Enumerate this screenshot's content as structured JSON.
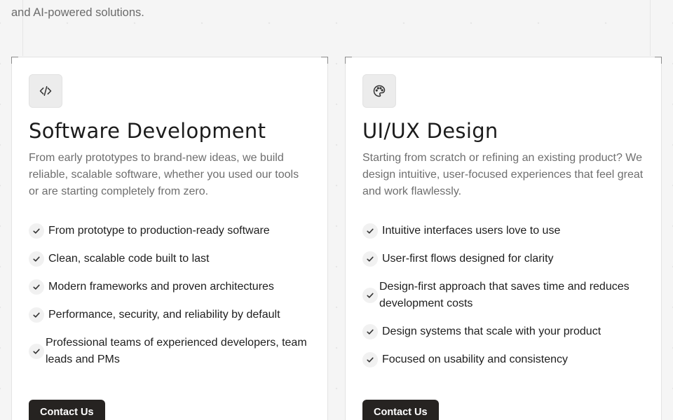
{
  "intro": {
    "text": "and AI-powered solutions."
  },
  "colors": {
    "button_bg": "#262321",
    "card_bg": "#ffffff",
    "icon_box_bg": "#ececec"
  },
  "cards": [
    {
      "icon": "code-icon",
      "title": "Software Development",
      "description": "From early prototypes to brand-new ideas, we build reliable, scalable software, whether you used our tools or are starting completely from zero.",
      "features": [
        "From prototype to production-ready software",
        "Clean, scalable code built to last",
        "Modern frameworks and proven architectures",
        "Performance, security, and reliability by default",
        "Professional teams of experienced developers, team leads and PMs"
      ],
      "button_label": "Contact Us"
    },
    {
      "icon": "palette-icon",
      "title": "UI/UX Design",
      "description": "Starting from scratch or refining an existing product? We design intuitive, user-focused experiences that feel great and work flawlessly.",
      "features": [
        "Intuitive interfaces users love to use",
        "User-first flows designed for clarity",
        "Design-first approach that saves time and reduces development costs",
        "Design systems that scale with your product",
        "Focused on usability and consistency"
      ],
      "button_label": "Contact Us"
    }
  ]
}
